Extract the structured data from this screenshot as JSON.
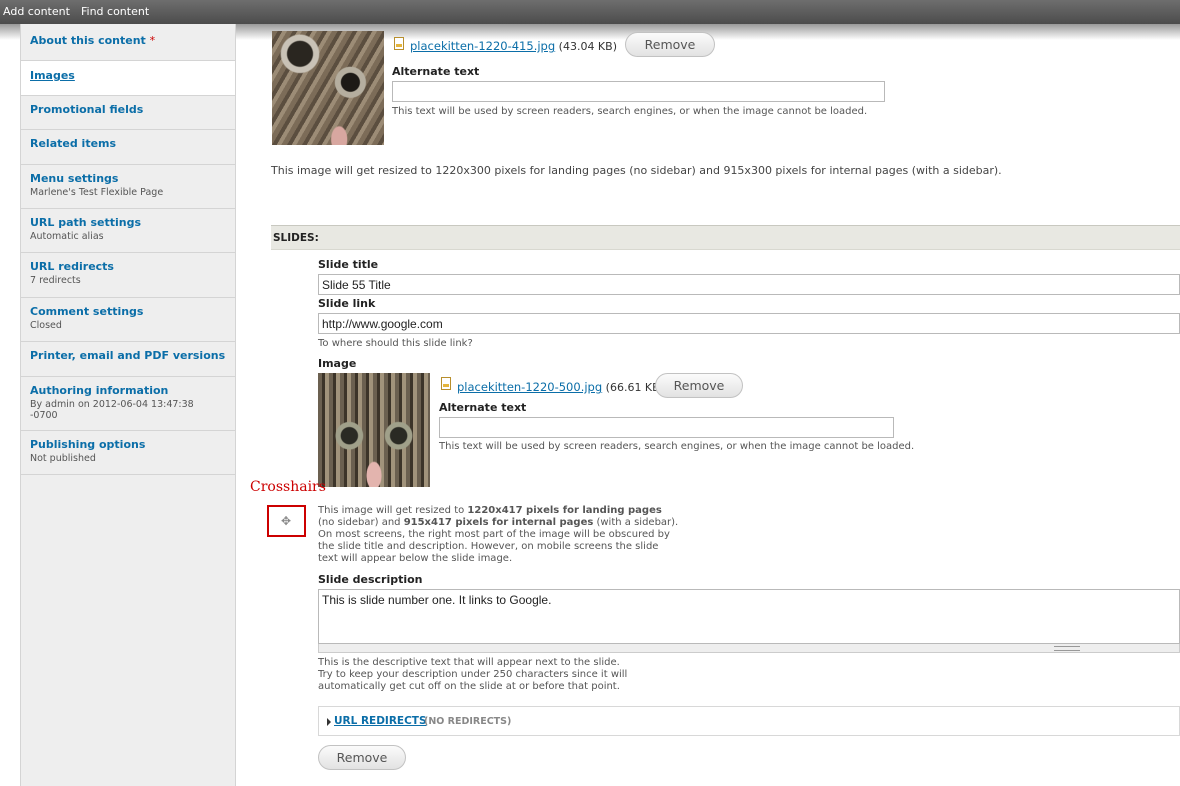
{
  "toolbar": {
    "add_content": "Add content",
    "find_content": "Find content"
  },
  "sidebar": {
    "items": [
      {
        "label": "About this content",
        "required": "*",
        "summary": ""
      },
      {
        "label": "Images",
        "summary": ""
      },
      {
        "label": "Promotional fields",
        "summary": ""
      },
      {
        "label": "Related items",
        "summary": ""
      },
      {
        "label": "Menu settings",
        "summary": "Marlene's Test Flexible Page"
      },
      {
        "label": "URL path settings",
        "summary": "Automatic alias"
      },
      {
        "label": "URL redirects",
        "summary": "7 redirects"
      },
      {
        "label": "Comment settings",
        "summary": "Closed"
      },
      {
        "label": "Printer, email and PDF versions",
        "summary": ""
      },
      {
        "label": "Authoring information",
        "summary_line1": "By admin on 2012-06-04 13:47:38",
        "summary_line2": "-0700"
      },
      {
        "label": "Publishing options",
        "summary": "Not published"
      }
    ]
  },
  "top_image": {
    "file_name": "placekitten-1220-415.jpg",
    "file_size": "(43.04 KB)",
    "remove_label": "Remove",
    "alt_label": "Alternate text",
    "alt_value": "",
    "alt_help": "This text will be used by screen readers, search engines, or when the image cannot be loaded.",
    "resize_note": "This image will get resized to 1220x300 pixels for landing pages (no sidebar) and 915x300 pixels for internal pages (with a sidebar)."
  },
  "slides": {
    "section_label": "SLIDES:",
    "title_label": "Slide title",
    "title_value": "Slide 55 Title",
    "link_label": "Slide link",
    "link_value": "http://www.google.com",
    "link_help": "To where should this slide link?",
    "image_label": "Image",
    "file_name": "placekitten-1220-500.jpg",
    "file_size": "(66.61 KB)",
    "remove_image_label": "Remove",
    "alt_label": "Alternate text",
    "alt_value": "",
    "alt_help": "This text will be used by screen readers, search engines, or when the image cannot be loaded.",
    "resize_note": {
      "p1": "This image will get resized to ",
      "b1": "1220x417 pixels for landing pages",
      "p2": "(no sidebar) and ",
      "b2": "915x417 pixels for internal pages",
      "p3": " (with a sidebar).",
      "l3": "On most screens, the right most part of the image will be obscured by",
      "l4": "the slide title and description. However, on mobile screens the slide",
      "l5": "text will appear below the slide image."
    },
    "description_label": "Slide description",
    "description_value": "This is slide number one. It links to Google.",
    "description_help_1": "This is the descriptive text that will appear next to the slide.",
    "description_help_2": "Try to keep your description under 250 characters since it will",
    "description_help_3": "automatically get cut off on the slide at or before that point.",
    "url_redirects_label": "URL REDIRECTS",
    "url_redirects_summary": "(NO REDIRECTS)",
    "remove_slide_label": "Remove"
  },
  "annotation": {
    "label": "Crosshairs",
    "color": "#cc0000",
    "icon": "move-crosshairs-icon"
  },
  "colors": {
    "link": "#0b6ea8",
    "annotation": "#cc0000"
  }
}
